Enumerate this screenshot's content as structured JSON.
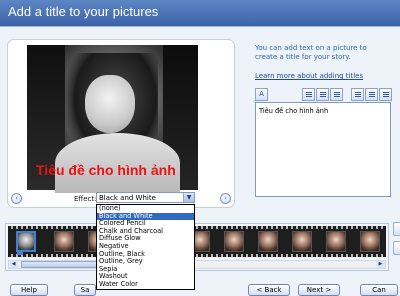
{
  "header": {
    "title": "Add a title to your pictures"
  },
  "preview": {
    "overlay_title": "Tiêu đề cho hình ảnh",
    "effect_label": "Effect:",
    "effect_selected": "Black and White"
  },
  "effect_options": [
    "(none)",
    "Black and White",
    "Colored Pencil",
    "Chalk and Charcoal",
    "Diffuse Glow",
    "Negative",
    "Outline, Black",
    "Outline, Grey",
    "Sepia",
    "Washout",
    "Water Color"
  ],
  "info": {
    "description": "You can add text on a picture to create a title for your story.",
    "link": "Learn more about adding titles"
  },
  "title_text": {
    "value": "Tiêu đề cho hình ảnh"
  },
  "buttons": {
    "help": "Help",
    "save": "Sa",
    "back": "< Back",
    "next": "Next >",
    "cancel": "Can"
  },
  "icons": {
    "prev": "‹",
    "next": "›",
    "dropdown": "▼",
    "font": "font-icon"
  },
  "colors": {
    "header": "#3b63a8",
    "overlay_title": "#ee1111",
    "selection": "#316ac5",
    "link": "#1f4aa3"
  }
}
